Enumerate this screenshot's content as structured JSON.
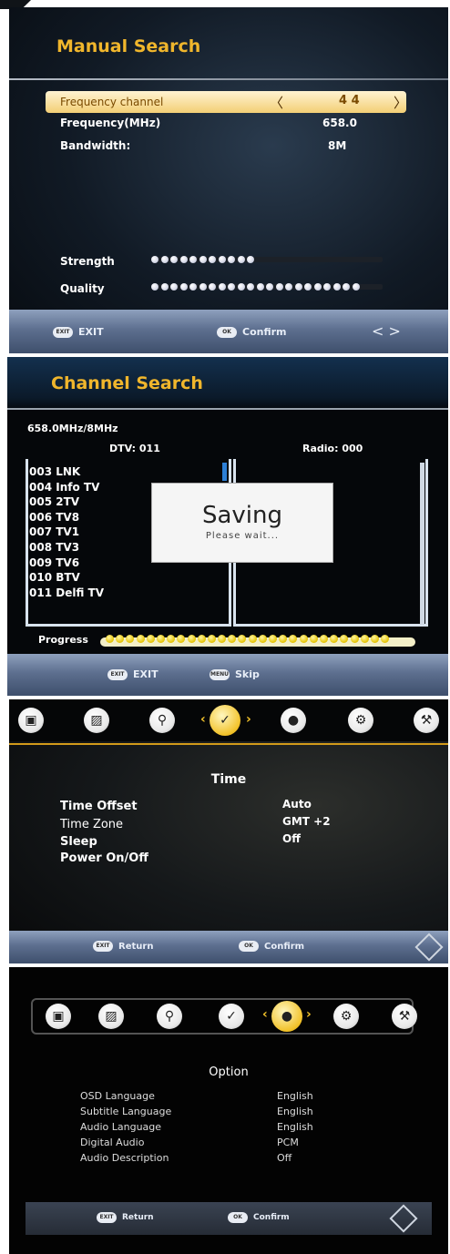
{
  "manual_search": {
    "title": "Manual Search",
    "rows": {
      "frequency_channel_label": "Frequency channel",
      "frequency_channel_value": "4 4",
      "frequency_label": "Frequency(MHz)",
      "frequency_value": "658.0",
      "bandwidth_label": "Bandwidth:",
      "bandwidth_value": "8M"
    },
    "strength_label": "Strength",
    "quality_label": "Quality",
    "strength_level": 0.45,
    "quality_level": 0.92,
    "footer": {
      "exit_badge": "EXIT",
      "exit_label": "EXIT",
      "confirm_badge": "OK",
      "confirm_label": "Confirm",
      "nav_arrows": "< >"
    }
  },
  "channel_search": {
    "title": "Channel Search",
    "freq_info": "658.0MHz/8MHz",
    "dtv_count": "DTV: 011",
    "radio_count": "Radio: 000",
    "channels": [
      "003 LNK",
      "004 Info TV",
      "005 2TV",
      "006 TV8",
      "007 TV1",
      "008 TV3",
      "009 TV6",
      "010 BTV",
      "011 Delfi TV"
    ],
    "saving_title": "Saving",
    "saving_sub": "Please wait...",
    "progress_label": "Progress",
    "progress_level": 0.94,
    "footer": {
      "exit_badge": "EXIT",
      "exit_label": "EXIT",
      "skip_badge": "MENU",
      "skip_label": "Skip"
    }
  },
  "time_menu": {
    "section_title": "Time",
    "options": [
      {
        "label": "Time Offset",
        "value": "Auto"
      },
      {
        "label": "Time Zone",
        "value": "GMT +2"
      },
      {
        "label": "Sleep",
        "value": "Off"
      },
      {
        "label": "Power On/Off",
        "value": ""
      }
    ],
    "footer": {
      "return_badge": "EXIT",
      "return_label": "Return",
      "confirm_badge": "OK",
      "confirm_label": "Confirm"
    }
  },
  "option_menu": {
    "section_title": "Option",
    "options": [
      {
        "label": "OSD Language",
        "value": "English"
      },
      {
        "label": "Subtitle Language",
        "value": "English"
      },
      {
        "label": "Audio Language",
        "value": "English"
      },
      {
        "label": "Digital Audio",
        "value": "PCM"
      },
      {
        "label": "Audio Description",
        "value": "Off"
      }
    ],
    "footer": {
      "return_badge": "EXIT",
      "return_label": "Return",
      "confirm_badge": "OK",
      "confirm_label": "Confirm"
    }
  },
  "menu_icons": [
    "tv-icon",
    "picture-icon",
    "search-icon",
    "clock-icon",
    "globe-icon",
    "gear-icon",
    "wrench-icon"
  ],
  "colors": {
    "title_gold": "#f0b62c",
    "highlight": "#f3cf75",
    "accent_blue": "#2c7fd6"
  }
}
